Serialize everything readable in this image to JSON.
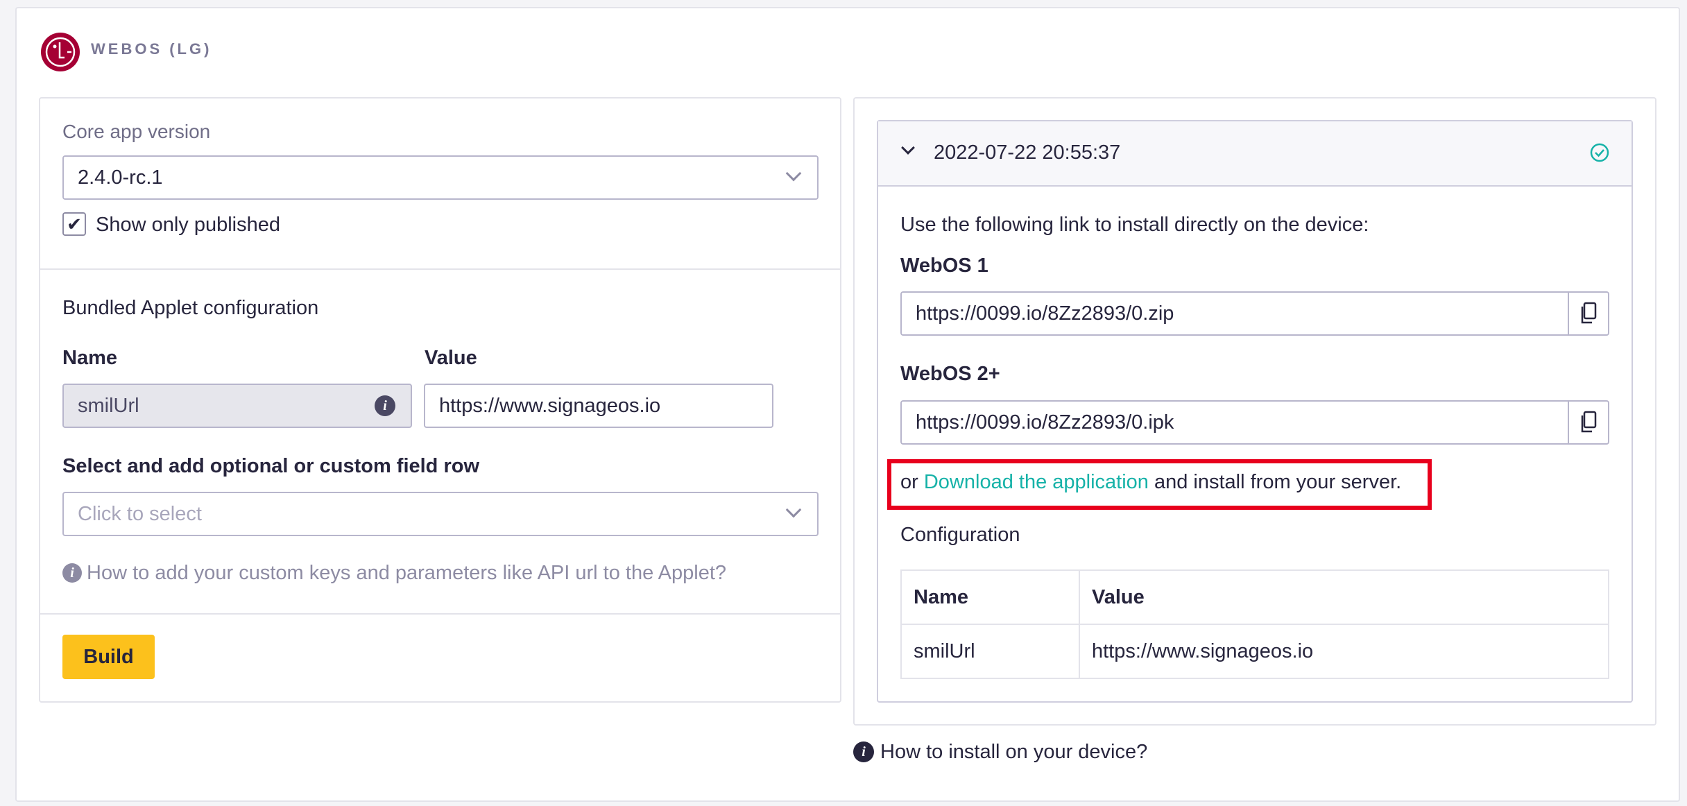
{
  "header": {
    "platform_title": "WEBOS (LG)"
  },
  "left": {
    "core_version": {
      "label": "Core app version",
      "value": "2.4.0-rc.1"
    },
    "show_published": {
      "label": "Show only published",
      "checked": true
    },
    "bundled": {
      "section_title": "Bundled Applet configuration",
      "name_header": "Name",
      "value_header": "Value",
      "name_value": "smilUrl",
      "value_value": "https://www.signageos.io"
    },
    "custom_field": {
      "label": "Select and add optional or custom field row",
      "placeholder": "Click to select"
    },
    "help_text": "How to add your custom keys and parameters like API url to the Applet?",
    "build_label": "Build"
  },
  "right": {
    "build_timestamp": "2022-07-22 20:55:37",
    "install_intro": "Use the following link to install directly on the device:",
    "webos1": {
      "label": "WebOS 1",
      "url": "https://0099.io/8Zz2893/0.zip"
    },
    "webos2": {
      "label": "WebOS 2+",
      "url": "https://0099.io/8Zz2893/0.ipk"
    },
    "download": {
      "prefix": "or",
      "link": "Download the application",
      "suffix": "and install from your server."
    },
    "configuration": {
      "title": "Configuration",
      "columns": [
        "Name",
        "Value"
      ],
      "rows": [
        [
          "smilUrl",
          "https://www.signageos.io"
        ]
      ]
    },
    "install_help": "How to install on your device?"
  },
  "colors": {
    "accent": "#16b2a8",
    "build_button": "#fcc11c",
    "highlight": "#e8001c",
    "lg_brand": "#a50034"
  }
}
